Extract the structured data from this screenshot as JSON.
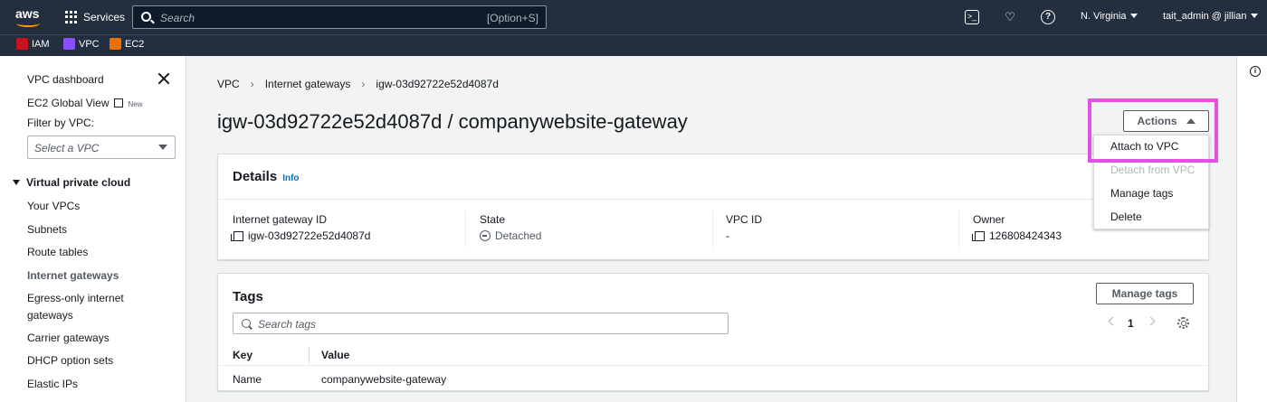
{
  "topnav": {
    "logo": "aws",
    "services_label": "Services",
    "search_placeholder": "Search",
    "search_shortcut": "[Option+S]",
    "region": "N. Virginia",
    "account": "tait_admin @ jillian"
  },
  "favorites": [
    {
      "label": "IAM",
      "color": "#c7131f"
    },
    {
      "label": "VPC",
      "color": "#8c4fff"
    },
    {
      "label": "EC2",
      "color": "#ed7100"
    }
  ],
  "sidebar": {
    "dashboard": "VPC dashboard",
    "global_view": "EC2 Global View",
    "new_badge": "New",
    "filter_label": "Filter by VPC:",
    "filter_placeholder": "Select a VPC",
    "section": "Virtual private cloud",
    "items": [
      {
        "label": "Your VPCs"
      },
      {
        "label": "Subnets"
      },
      {
        "label": "Route tables"
      },
      {
        "label": "Internet gateways",
        "active": true
      },
      {
        "label": "Egress-only internet"
      },
      {
        "label": "gateways"
      },
      {
        "label": "Carrier gateways"
      },
      {
        "label": "DHCP option sets"
      },
      {
        "label": "Elastic IPs"
      }
    ]
  },
  "breadcrumb": [
    "VPC",
    "Internet gateways",
    "igw-03d92722e52d4087d"
  ],
  "page_title": "igw-03d92722e52d4087d / companywebsite-gateway",
  "actions": {
    "button_label": "Actions",
    "menu": [
      {
        "label": "Attach to VPC",
        "disabled": false
      },
      {
        "label": "Detach from VPC",
        "disabled": true
      },
      {
        "label": "Manage tags",
        "disabled": false
      },
      {
        "label": "Delete",
        "disabled": false
      }
    ],
    "highlight_color": "#e64ee8"
  },
  "details": {
    "title": "Details",
    "info": "Info",
    "fields": [
      {
        "label": "Internet gateway ID",
        "value": "igw-03d92722e52d4087d"
      },
      {
        "label": "State",
        "value": "Detached"
      },
      {
        "label": "VPC ID",
        "value": "-"
      },
      {
        "label": "Owner",
        "value": "126808424343"
      }
    ]
  },
  "tags": {
    "title": "Tags",
    "manage_button": "Manage tags",
    "search_placeholder": "Search tags",
    "page": "1",
    "columns": [
      "Key",
      "Value"
    ],
    "rows": [
      {
        "key": "Name",
        "value": "companywebsite-gateway"
      }
    ]
  }
}
